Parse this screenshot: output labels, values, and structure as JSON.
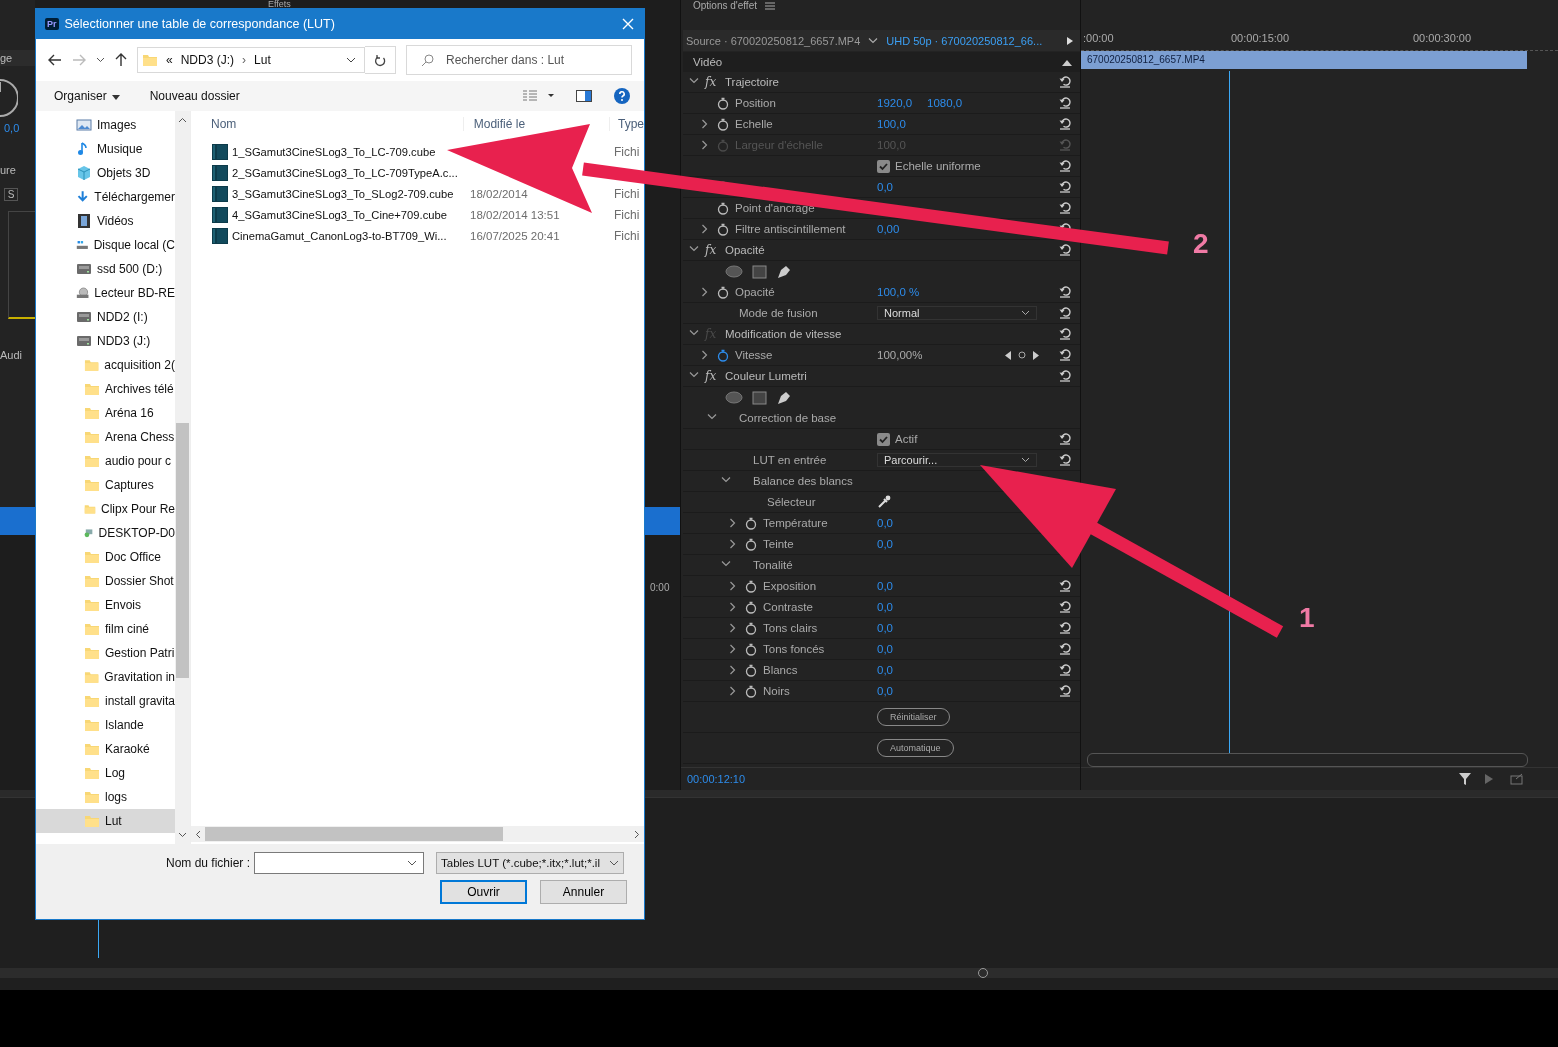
{
  "background": {
    "top_tab": "Effets",
    "left_fragments": [
      "ge",
      "0,0",
      "ure",
      "S",
      "Audi"
    ],
    "right_fragment": "0:00"
  },
  "dialog": {
    "title": "Sélectionner une table de correspondance (LUT)",
    "app_badge": "Pr",
    "address": {
      "prefix": "«",
      "parts": [
        "NDD3 (J:)",
        "Lut"
      ],
      "separator": "›"
    },
    "search": {
      "placeholder": "Rechercher dans : Lut"
    },
    "commands": [
      "Organiser",
      "Nouveau dossier"
    ],
    "sidebar": [
      {
        "label": "Images",
        "kind": "pictures",
        "selected": false
      },
      {
        "label": "Musique",
        "kind": "music",
        "selected": false
      },
      {
        "label": "Objets 3D",
        "kind": "cube",
        "selected": false
      },
      {
        "label": "Téléchargemer",
        "kind": "download",
        "selected": false
      },
      {
        "label": "Vidéos",
        "kind": "film",
        "selected": false
      },
      {
        "label": "Disque local (C",
        "kind": "system-drive",
        "selected": false
      },
      {
        "label": "ssd 500 (D:)",
        "kind": "drive",
        "selected": false
      },
      {
        "label": "Lecteur BD-RE",
        "kind": "disc",
        "selected": false
      },
      {
        "label": "NDD2 (I:)",
        "kind": "drive",
        "selected": false
      },
      {
        "label": "NDD3 (J:)",
        "kind": "drive",
        "selected": false,
        "children": [
          {
            "label": "acquisition 2(",
            "kind": "folder",
            "selected": false
          },
          {
            "label": "Archives télé",
            "kind": "folder",
            "selected": false
          },
          {
            "label": "Aréna 16",
            "kind": "folder",
            "selected": false
          },
          {
            "label": "Arena Chess",
            "kind": "folder",
            "selected": false
          },
          {
            "label": "audio pour c",
            "kind": "folder",
            "selected": false
          },
          {
            "label": "Captures",
            "kind": "folder",
            "selected": false
          },
          {
            "label": "Clipx Pour Re",
            "kind": "folder",
            "selected": false
          },
          {
            "label": "DESKTOP-D0",
            "kind": "network",
            "selected": false
          },
          {
            "label": "Doc Office",
            "kind": "folder",
            "selected": false
          },
          {
            "label": "Dossier Shot",
            "kind": "folder",
            "selected": false
          },
          {
            "label": "Envois",
            "kind": "folder",
            "selected": false
          },
          {
            "label": "film ciné",
            "kind": "folder",
            "selected": false
          },
          {
            "label": "Gestion Patri",
            "kind": "folder",
            "selected": false
          },
          {
            "label": "Gravitation in",
            "kind": "folder",
            "selected": false
          },
          {
            "label": "install gravita",
            "kind": "folder",
            "selected": false
          },
          {
            "label": "Islande",
            "kind": "folder",
            "selected": false
          },
          {
            "label": "Karaoké",
            "kind": "folder",
            "selected": false
          },
          {
            "label": "Log",
            "kind": "folder",
            "selected": false
          },
          {
            "label": "logs",
            "kind": "folder",
            "selected": false
          },
          {
            "label": "Lut",
            "kind": "folder",
            "selected": true
          }
        ]
      }
    ],
    "columns": [
      "Nom",
      "Modifié le",
      "Type"
    ],
    "files": [
      {
        "name": "1_SGamut3CineSLog3_To_LC-709.cube",
        "type": "Fichi"
      },
      {
        "name": "2_SGamut3CineSLog3_To_LC-709TypeA.c..."
      },
      {
        "name": "3_SGamut3CineSLog3_To_SLog2-709.cube",
        "modified": "18/02/2014",
        "type": "Fichi"
      },
      {
        "name": "4_SGamut3CineSLog3_To_Cine+709.cube",
        "modified": "18/02/2014 13:51",
        "type": "Fichi"
      },
      {
        "name": "CinemaGamut_CanonLog3-to-BT709_Wi...",
        "modified": "16/07/2025 20:41",
        "type": "Fichi"
      }
    ],
    "filename_label": "Nom du fichier :",
    "filter": "Tables LUT (*.cube;*.itx;*.lut;*.il",
    "buttons": [
      "Ouvrir",
      "Annuler"
    ]
  },
  "effect_controls": {
    "title": "Options d'effet",
    "source": "Source · 670020250812_6657.MP4",
    "sequence": "UHD 50p · 670020250812_66...",
    "section": "Vidéo",
    "timecode": "00:00:12:10",
    "effects": [
      {
        "name": "Trajectoire",
        "badge": "fx",
        "expanded": true,
        "fx_enabled": true,
        "items": [
          {
            "kind": "param",
            "label": "Position",
            "values": [
              "1920,0",
              "1080,0"
            ],
            "expandable": false,
            "disabled": false,
            "animated": false
          },
          {
            "kind": "param",
            "label": "Echelle",
            "values": [
              "100,0"
            ],
            "expandable": true,
            "disabled": false,
            "animated": false
          },
          {
            "kind": "param",
            "label": "Largeur d'échelle",
            "values": [
              "100,0"
            ],
            "expandable": true,
            "disabled": true,
            "animated": false
          },
          {
            "kind": "checkbox",
            "label": "Echelle uniforme",
            "checked": true
          },
          {
            "kind": "param",
            "values": [
              "0,0"
            ]
          },
          {
            "kind": "param",
            "label": "Point d'ancrage",
            "expandable": false,
            "disabled": false,
            "animated": false
          },
          {
            "kind": "param",
            "label": "Filtre antiscintillement",
            "values": [
              "0,00"
            ],
            "expandable": true,
            "disabled": false,
            "animated": false
          }
        ]
      },
      {
        "name": "Opacité",
        "badge": "fx",
        "expanded": true,
        "fx_enabled": true,
        "items": [
          {
            "kind": "masks"
          },
          {
            "kind": "param",
            "label": "Opacité",
            "values": [
              "100,0 %"
            ],
            "expandable": true,
            "disabled": false,
            "animated": false
          },
          {
            "kind": "dropdown",
            "label": "Mode de fusion",
            "value": "Normal"
          }
        ]
      },
      {
        "name": "Modification de vitesse",
        "badge": "fx",
        "expanded": true,
        "fx_enabled": false,
        "items": [
          {
            "kind": "param",
            "label": "Vitesse",
            "values": [
              "100,00%"
            ],
            "expandable": true,
            "disabled": false,
            "animated": true
          }
        ]
      },
      {
        "name": "Couleur Lumetri",
        "badge": "fx",
        "expanded": true,
        "fx_enabled": true,
        "items": [
          {
            "kind": "masks"
          },
          {
            "kind": "group",
            "label": "Correction de base",
            "expanded": true,
            "children": [
              {
                "kind": "checkbox",
                "label": "Actif",
                "checked": true
              },
              {
                "kind": "dropdown",
                "label": "LUT en entrée",
                "value": "Parcourir..."
              },
              {
                "kind": "group",
                "label": "Balance des blancs",
                "expanded": true,
                "children": [
                  {
                    "kind": "picker",
                    "label": "Sélecteur"
                  },
                  {
                    "kind": "param",
                    "label": "Température",
                    "values": [
                      "0,0"
                    ],
                    "expandable": true,
                    "disabled": false,
                    "animated": false,
                    "reset": false
                  },
                  {
                    "kind": "param",
                    "label": "Teinte",
                    "values": [
                      "0,0"
                    ],
                    "expandable": true,
                    "disabled": false,
                    "animated": false,
                    "reset": false
                  }
                ]
              },
              {
                "kind": "group",
                "label": "Tonalité",
                "expanded": true,
                "children": [
                  {
                    "kind": "param",
                    "label": "Exposition",
                    "values": [
                      "0,0"
                    ],
                    "expandable": true,
                    "disabled": false,
                    "animated": false
                  },
                  {
                    "kind": "param",
                    "label": "Contraste",
                    "values": [
                      "0,0"
                    ],
                    "expandable": true,
                    "disabled": false,
                    "animated": false
                  },
                  {
                    "kind": "param",
                    "label": "Tons clairs",
                    "values": [
                      "0,0"
                    ],
                    "expandable": true,
                    "disabled": false,
                    "animated": false
                  },
                  {
                    "kind": "param",
                    "label": "Tons foncés",
                    "values": [
                      "0,0"
                    ],
                    "expandable": true,
                    "disabled": false,
                    "animated": false
                  },
                  {
                    "kind": "param",
                    "label": "Blancs",
                    "values": [
                      "0,0"
                    ],
                    "expandable": true,
                    "disabled": false,
                    "animated": false
                  },
                  {
                    "kind": "param",
                    "label": "Noirs",
                    "values": [
                      "0,0"
                    ],
                    "expandable": true,
                    "disabled": false,
                    "animated": false
                  },
                  {
                    "kind": "button",
                    "label": "Réinitialiser"
                  },
                  {
                    "kind": "button",
                    "label": "Automatique"
                  }
                ]
              }
            ]
          }
        ]
      }
    ]
  },
  "timeline": {
    "ruler": [
      ":00:00",
      "00:00:15:00",
      "00:00:30:00"
    ],
    "clip": "670020250812_6657.MP4"
  },
  "annotations": [
    {
      "label": "2"
    },
    {
      "label": "1"
    }
  ]
}
